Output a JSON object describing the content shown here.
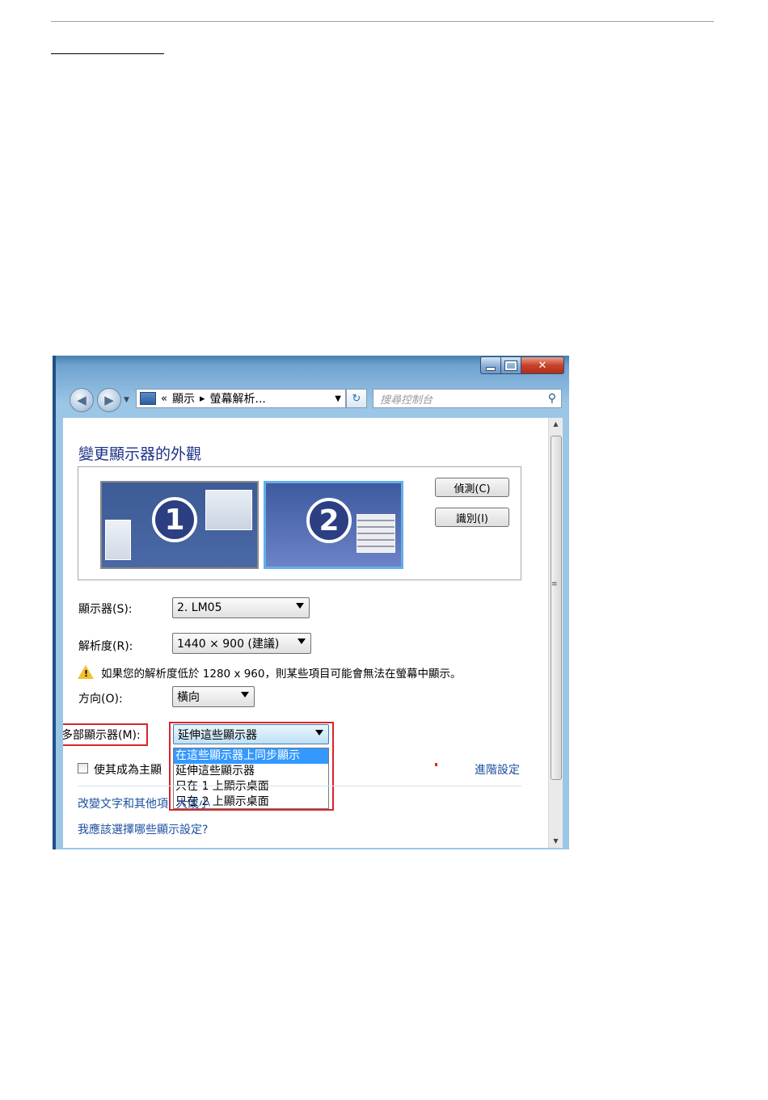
{
  "window": {
    "address": {
      "crumb_sep": "«",
      "crumbs": [
        "顯示",
        "螢幕解析..."
      ],
      "chevron": "▸"
    },
    "search": {
      "placeholder": "搜尋控制台"
    }
  },
  "page": {
    "title": "變更顯示器的外觀",
    "monitors": [
      {
        "number": "1"
      },
      {
        "number": "2"
      }
    ],
    "buttons": {
      "detect": "偵測(C)",
      "identify": "識別(I)"
    },
    "display": {
      "label": "顯示器(S):",
      "value": "2. LM05"
    },
    "resolution": {
      "label": "解析度(R):",
      "value": "1440 × 900 (建議)"
    },
    "warning": "如果您的解析度低於 1280 x 960，則某些項目可能會無法在螢幕中顯示。",
    "orientation": {
      "label": "方向(O):",
      "value": "橫向"
    },
    "multi_display": {
      "label": "多部顯示器(M):",
      "value": "延伸這些顯示器",
      "options": [
        "在這些顯示器上同步顯示",
        "延伸這些顯示器",
        "只在 1 上顯示桌面",
        "只在 2 上顯示桌面"
      ],
      "highlighted_index": 0
    },
    "primary_checkbox": {
      "label": "使其成為主顯",
      "checked": false
    },
    "advanced_link": "進階設定",
    "links": {
      "text_size": "改變文字和其他項",
      "text_size_tail": "大或小",
      "which_settings": "我應該選擇哪些顯示設定?"
    }
  },
  "icons": {
    "back": "arrow-left-icon",
    "forward": "arrow-right-icon",
    "refresh": "refresh-icon",
    "search": "magnifier-icon",
    "warning": "warning-triangle-icon",
    "minimize": "minimize-icon",
    "maximize": "maximize-icon",
    "close": "close-icon"
  },
  "colors": {
    "heading": "#1e3287",
    "link": "#1a4fa0",
    "highlight": "#3399ff",
    "annotation_red": "#d9252b"
  }
}
